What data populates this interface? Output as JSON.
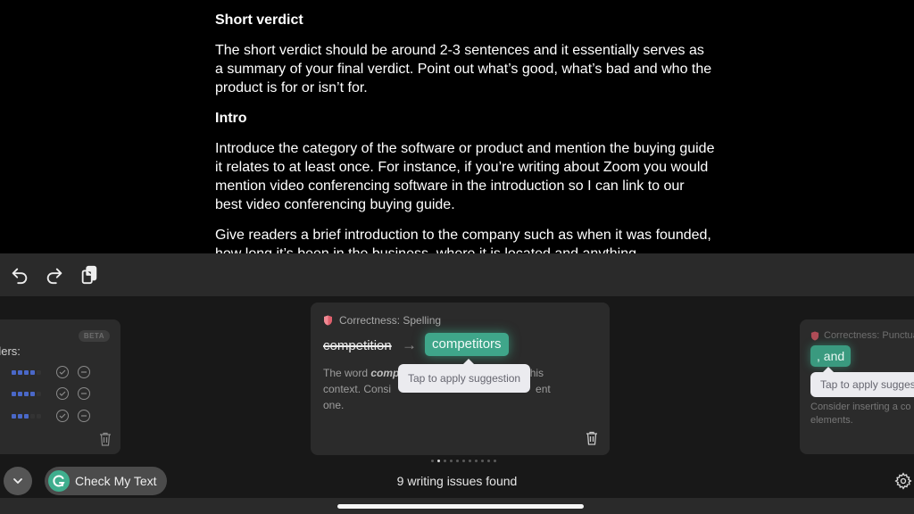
{
  "document": {
    "sections": [
      {
        "heading": "Short verdict",
        "paragraphs": [
          "The short verdict should be around 2-3 sentences and it essentially serves as a summary of your final verdict. Point out what’s good, what’s bad and who the product is for or isn’t for."
        ]
      },
      {
        "heading": "Intro",
        "paragraphs": [
          "Introduce the category of the software or product and mention the buying guide it relates to at least once. For instance, if you’re writing about Zoom you would mention video conferencing software in the introduction so I can link to our best video conferencing buying guide.",
          "Give readers a brief introduction to the company such as when it was founded, how long it’s been in the business, where it is located and anything"
        ]
      }
    ]
  },
  "toolbar": {
    "undo": "undo-icon",
    "redo": "redo-icon",
    "clipboard": "clipboard-icon"
  },
  "cards": {
    "left": {
      "badge": "BETA",
      "label": "ders:",
      "rows": [
        {
          "level": 4,
          "max": 5
        },
        {
          "level": 4,
          "max": 5
        },
        {
          "level": 3,
          "max": 5
        }
      ]
    },
    "center": {
      "category": "Correctness: Spelling",
      "original": "competition",
      "suggestion": "competitors",
      "explanation_prefix": "The word ",
      "explanation_italic": "comp",
      "explanation_line1_end": "this",
      "explanation_line2_start": "context. Consi",
      "explanation_line2_end": "ent",
      "explanation_line3": "one.",
      "tooltip": "Tap to apply suggestion"
    },
    "right": {
      "category": "Correctness: Punctua",
      "suggestion": ", and",
      "tooltip": "Tap to apply suggestion",
      "explanation": "Consider inserting a co elements."
    }
  },
  "pagination": {
    "total": 11,
    "active": 2
  },
  "bottom": {
    "check_label": "Check My Text",
    "issues": "9 writing issues found"
  },
  "colors": {
    "accent_green": "#3fa68a",
    "tone_blue": "#4a68c8",
    "shield_red": "#e0606d"
  }
}
